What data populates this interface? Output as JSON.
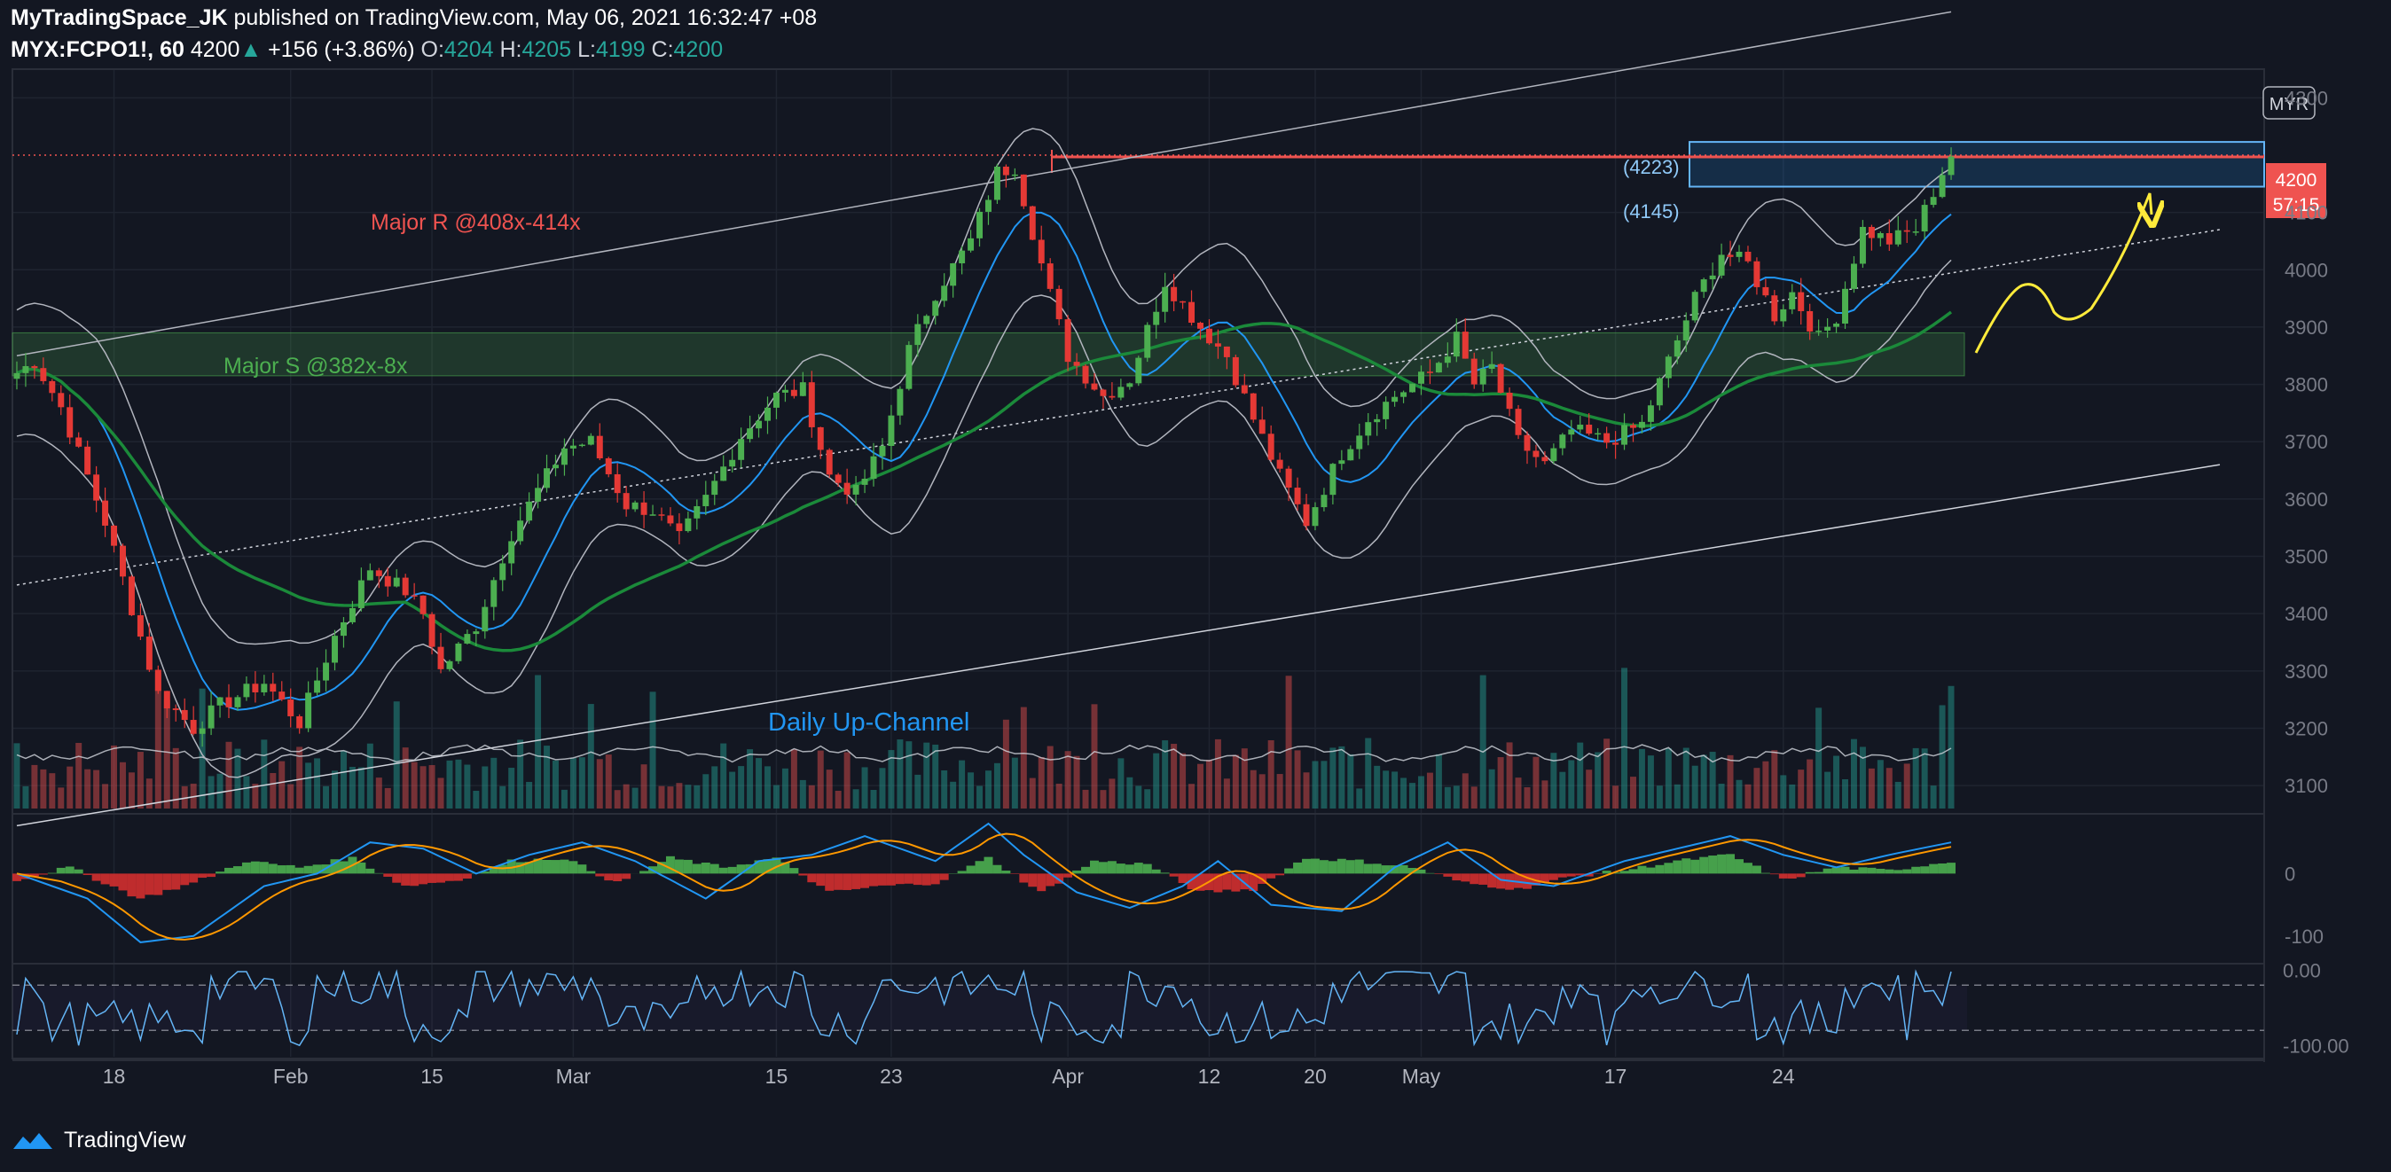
{
  "header": {
    "publisher": "MyTradingSpace_JK",
    "published_text": "published on TradingView.com, May 06, 2021 16:32:47 +08",
    "symbol": "MYX:FCPO1!, 60",
    "last": "4200",
    "change": "+156 (+3.86%)",
    "open_label": "O:",
    "open": "4204",
    "high_label": "H:",
    "high": "4205",
    "low_label": "L:",
    "low": "4199",
    "close_label": "C:",
    "close": "4200"
  },
  "footer": {
    "brand": "TradingView"
  },
  "colors": {
    "background": "#131722",
    "up": "#26a69a",
    "down": "#ef5350",
    "candle_up": "#4caf50",
    "candle_down": "#e53935",
    "resistance": "#ef5350",
    "support": "#4caf50",
    "channel": "#90caf9",
    "bb": "#b2b5be",
    "ma_fast": "#2196f3",
    "ma_slow": "#1b8a3a",
    "annotation": "#ffeb3b",
    "price_tag": "#ef5350",
    "grid": "#1f2430"
  },
  "annotations": {
    "major_r": "Major R @408x-414x",
    "major_s": "Major S @382x-8x",
    "channel": "Daily Up-Channel",
    "zone_top": "(4223)",
    "zone_bottom": "(4145)"
  },
  "chart_data": [
    {
      "type": "line",
      "subtype": "candlestick",
      "currency": "MYR",
      "x_tick_labels": [
        "18",
        "Feb",
        "15",
        "Mar",
        "15",
        "23",
        "Apr",
        "12",
        "20",
        "May",
        "17",
        "24"
      ],
      "y_ticks": [
        3100,
        3200,
        3300,
        3400,
        3500,
        3600,
        3700,
        3800,
        3900,
        4000,
        4100,
        4300
      ],
      "ylim": [
        3060,
        4350
      ],
      "last_price": "4200",
      "countdown": "57:15",
      "resistance_line": 4200,
      "zone_range": [
        4145,
        4223
      ],
      "support_zone": [
        3815,
        3890
      ],
      "price_keypoints": [
        [
          0,
          3820
        ],
        [
          2,
          3840
        ],
        [
          5,
          3760
        ],
        [
          10,
          3560
        ],
        [
          16,
          3260
        ],
        [
          20,
          3200
        ],
        [
          23,
          3240
        ],
        [
          28,
          3280
        ],
        [
          32,
          3210
        ],
        [
          36,
          3360
        ],
        [
          40,
          3480
        ],
        [
          44,
          3440
        ],
        [
          46,
          3400
        ],
        [
          48,
          3300
        ],
        [
          52,
          3380
        ],
        [
          56,
          3540
        ],
        [
          58,
          3590
        ],
        [
          62,
          3690
        ],
        [
          65,
          3700
        ],
        [
          69,
          3590
        ],
        [
          72,
          3580
        ],
        [
          75,
          3530
        ],
        [
          78,
          3600
        ],
        [
          82,
          3710
        ],
        [
          86,
          3780
        ],
        [
          89,
          3790
        ],
        [
          92,
          3640
        ],
        [
          95,
          3610
        ],
        [
          98,
          3690
        ],
        [
          101,
          3860
        ],
        [
          104,
          3960
        ],
        [
          108,
          4050
        ],
        [
          111,
          4170
        ],
        [
          113,
          4180
        ],
        [
          116,
          4010
        ],
        [
          119,
          3850
        ],
        [
          123,
          3780
        ],
        [
          126,
          3810
        ],
        [
          130,
          3980
        ],
        [
          134,
          3900
        ],
        [
          137,
          3850
        ],
        [
          140,
          3740
        ],
        [
          143,
          3640
        ],
        [
          146,
          3560
        ],
        [
          150,
          3680
        ],
        [
          153,
          3740
        ],
        [
          156,
          3780
        ],
        [
          160,
          3820
        ],
        [
          163,
          3880
        ],
        [
          165,
          3800
        ],
        [
          167,
          3830
        ],
        [
          170,
          3700
        ],
        [
          173,
          3660
        ],
        [
          176,
          3720
        ],
        [
          180,
          3700
        ],
        [
          184,
          3730
        ],
        [
          187,
          3840
        ],
        [
          190,
          3950
        ],
        [
          193,
          4030
        ],
        [
          196,
          4010
        ],
        [
          199,
          3920
        ],
        [
          201,
          3960
        ],
        [
          204,
          3880
        ],
        [
          206,
          3920
        ],
        [
          209,
          4070
        ],
        [
          212,
          4050
        ],
        [
          215,
          4070
        ],
        [
          218,
          4170
        ],
        [
          219,
          4200
        ]
      ],
      "bollinger_halfwidth_keypoints": [
        [
          0,
          110
        ],
        [
          16,
          150
        ],
        [
          30,
          100
        ],
        [
          46,
          90
        ],
        [
          60,
          130
        ],
        [
          75,
          90
        ],
        [
          90,
          100
        ],
        [
          110,
          160
        ],
        [
          125,
          120
        ],
        [
          145,
          150
        ],
        [
          165,
          90
        ],
        [
          185,
          70
        ],
        [
          200,
          140
        ],
        [
          219,
          80
        ]
      ],
      "moving_averages": [
        {
          "period": "fast",
          "lag": 10
        },
        {
          "period": "slow",
          "lag": 45
        }
      ],
      "channel_lines": {
        "upper": [
          [
            0,
            3850
          ],
          [
            219,
            4450
          ]
        ],
        "middle": [
          [
            0,
            3450
          ],
          [
            219,
            4040
          ]
        ],
        "lower": [
          [
            0,
            3030
          ],
          [
            219,
            3640
          ]
        ]
      },
      "projection": "yellow arrow towards 4180"
    },
    {
      "type": "bar",
      "subtype": "macd",
      "y_ticks": [
        "0",
        "-100"
      ],
      "ylim": [
        -140,
        90
      ],
      "histogram_keypoints": [
        [
          0,
          -10
        ],
        [
          6,
          10
        ],
        [
          14,
          -40
        ],
        [
          20,
          -15
        ],
        [
          26,
          20
        ],
        [
          32,
          10
        ],
        [
          38,
          25
        ],
        [
          44,
          -20
        ],
        [
          50,
          -10
        ],
        [
          56,
          20
        ],
        [
          62,
          25
        ],
        [
          68,
          -15
        ],
        [
          74,
          25
        ],
        [
          80,
          10
        ],
        [
          86,
          25
        ],
        [
          92,
          -30
        ],
        [
          98,
          -20
        ],
        [
          104,
          -15
        ],
        [
          110,
          25
        ],
        [
          116,
          -30
        ],
        [
          122,
          20
        ],
        [
          128,
          15
        ],
        [
          134,
          -30
        ],
        [
          140,
          -25
        ],
        [
          146,
          25
        ],
        [
          152,
          20
        ],
        [
          158,
          10
        ],
        [
          164,
          -15
        ],
        [
          170,
          -25
        ],
        [
          176,
          -5
        ],
        [
          182,
          5
        ],
        [
          188,
          20
        ],
        [
          194,
          30
        ],
        [
          200,
          -10
        ],
        [
          206,
          10
        ],
        [
          212,
          5
        ],
        [
          219,
          20
        ]
      ],
      "macd_keypoints": [
        [
          0,
          0
        ],
        [
          8,
          -40
        ],
        [
          14,
          -110
        ],
        [
          20,
          -100
        ],
        [
          28,
          -20
        ],
        [
          34,
          0
        ],
        [
          40,
          50
        ],
        [
          46,
          40
        ],
        [
          52,
          0
        ],
        [
          58,
          30
        ],
        [
          64,
          50
        ],
        [
          70,
          20
        ],
        [
          78,
          -40
        ],
        [
          84,
          20
        ],
        [
          90,
          30
        ],
        [
          96,
          60
        ],
        [
          104,
          20
        ],
        [
          110,
          80
        ],
        [
          114,
          30
        ],
        [
          120,
          -30
        ],
        [
          126,
          -55
        ],
        [
          132,
          -20
        ],
        [
          136,
          20
        ],
        [
          142,
          -50
        ],
        [
          150,
          -60
        ],
        [
          156,
          10
        ],
        [
          162,
          50
        ],
        [
          168,
          -10
        ],
        [
          174,
          -20
        ],
        [
          182,
          20
        ],
        [
          188,
          40
        ],
        [
          194,
          60
        ],
        [
          200,
          30
        ],
        [
          206,
          10
        ],
        [
          212,
          30
        ],
        [
          219,
          50
        ]
      ]
    },
    {
      "type": "line",
      "subtype": "williams-r",
      "y_ticks": [
        "0.00",
        "-100.00"
      ],
      "ylim": [
        -115,
        5
      ],
      "reference_levels": [
        -20,
        -80
      ]
    }
  ]
}
